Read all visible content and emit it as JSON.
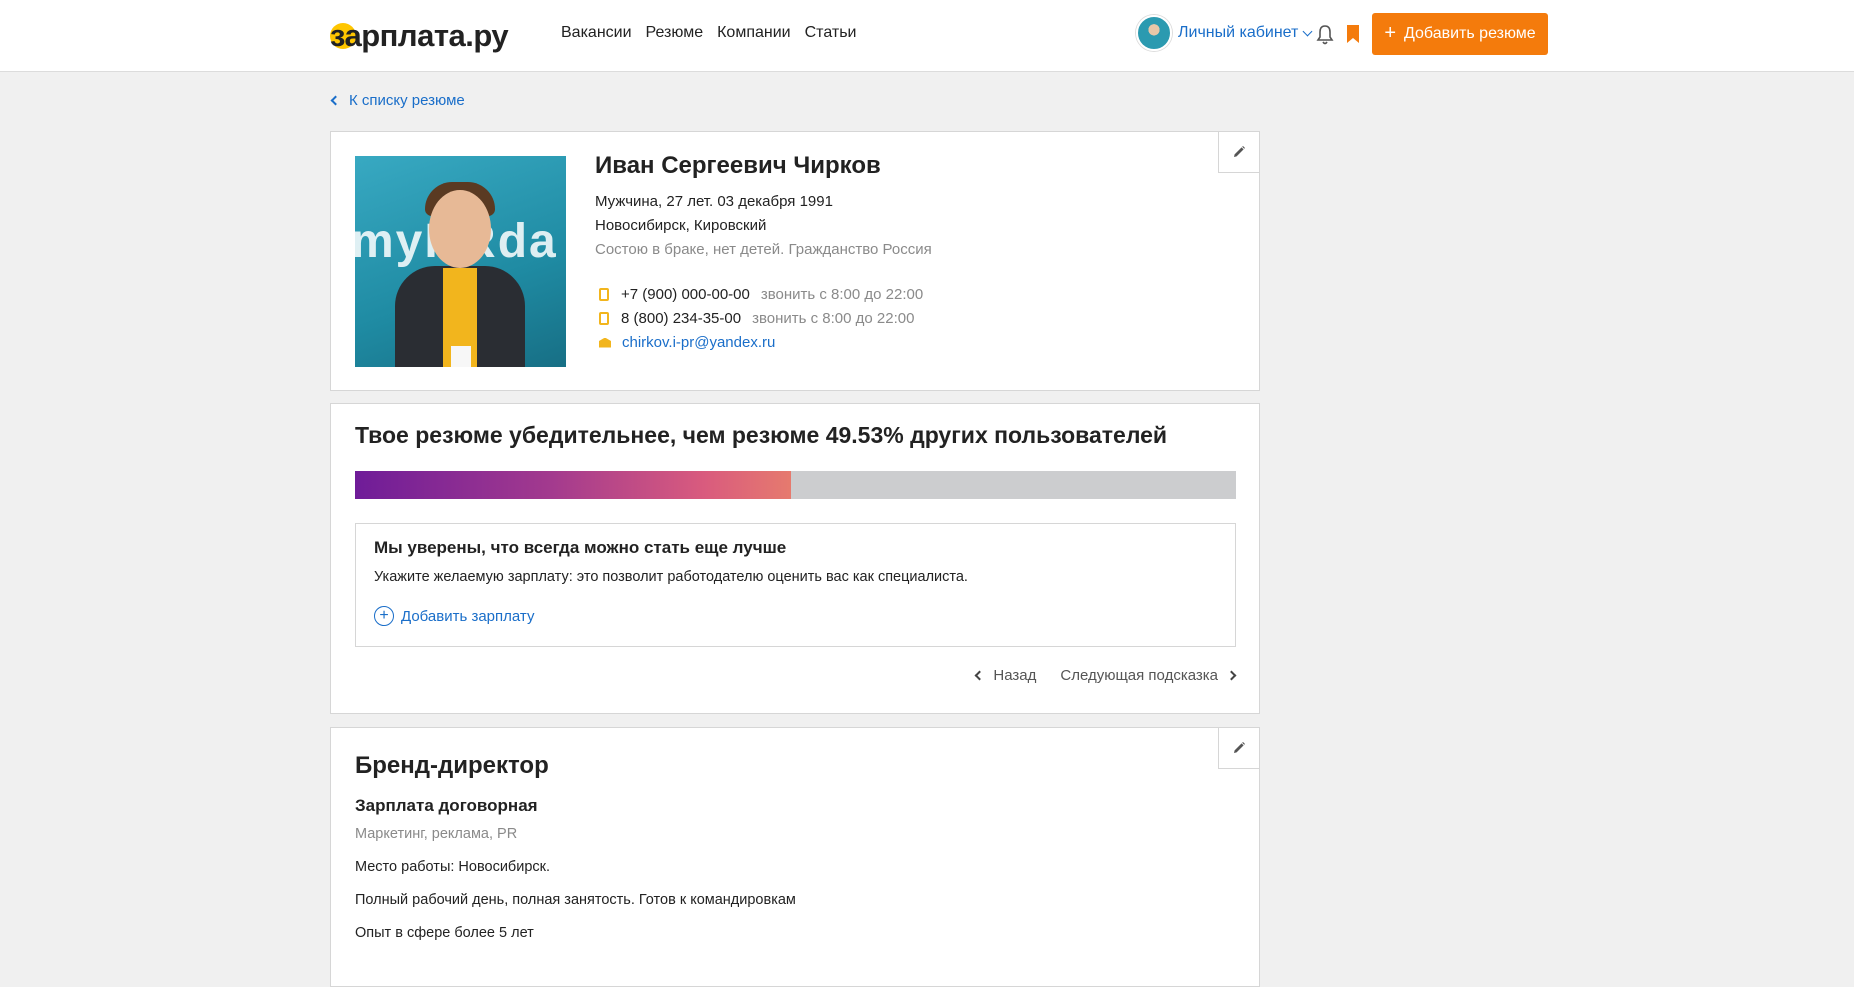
{
  "header": {
    "logo": "зарплата.ру",
    "nav": [
      "Вакансии",
      "Резюме",
      "Компании",
      "Статьи"
    ],
    "cabinet_label": "Личный кабинет",
    "add_resume_label": "Добавить резюме",
    "accent_color": "#f47b0c"
  },
  "back_link": "К списку резюме",
  "profile": {
    "name": "Иван Сергеевич Чирков",
    "info": "Мужчина, 27 лет. 03 декабря 1991",
    "location": "Новосибирск, Кировский",
    "family": "Состою в браке, нет детей. Гражданство Россия",
    "contacts": [
      {
        "icon": "phone-icon",
        "value": "+7 (900) 000-00-00",
        "hint": "звонить с 8:00 до 22:00"
      },
      {
        "icon": "phone-icon",
        "value": "8 (800) 234-35-00",
        "hint": "звонить с 8:00 до 22:00"
      },
      {
        "icon": "mail-icon",
        "value": "chirkov.i-pr@yandex.ru"
      }
    ]
  },
  "score": {
    "title": "Твое резюме убедительнее, чем резюме 49.53% других пользователей",
    "percent": 49.53,
    "tip_title": "Мы уверены, что всегда можно стать еще лучше",
    "tip_text": "Укажите желаемую зарплату: это позволит работодателю оценить вас как специалиста.",
    "tip_action": "Добавить зарплату",
    "prev_label": "Назад",
    "next_label": "Следующая подсказка"
  },
  "position": {
    "title": "Бренд-директор",
    "salary": "Зарплата договорная",
    "sphere": "Маркетинг, реклама, PR",
    "place": "Место работы: Новосибирск.",
    "schedule": "Полный рабочий день, полная занятость. Готов к командировкам",
    "experience": "Опыт в сфере более 5 лет"
  }
}
